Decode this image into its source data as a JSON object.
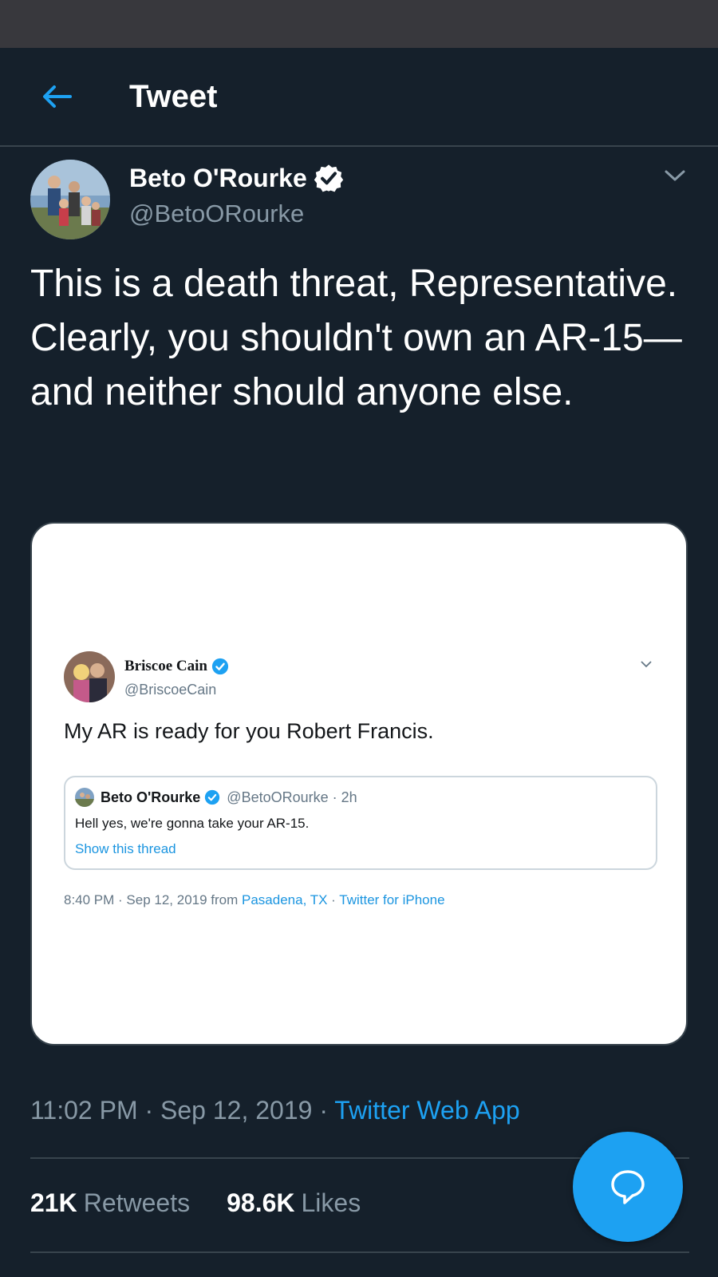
{
  "header": {
    "title": "Tweet",
    "back_icon": "arrow-left-icon"
  },
  "tweet": {
    "author_name": "Beto O'Rourke",
    "author_handle": "@BetoORourke",
    "text": "This is a death threat, Representative. Clearly, you shouldn't own an AR-15—and neither should anyone else.",
    "time": "11:02 PM",
    "date": "Sep 12, 2019",
    "source": "Twitter Web App",
    "retweets_count": "21K",
    "retweets_label": "Retweets",
    "likes_count": "98.6K",
    "likes_label": "Likes"
  },
  "media": {
    "quoted_name": "Briscoe Cain",
    "quoted_handle": "@BriscoeCain",
    "quoted_text": "My AR is ready for you Robert Francis.",
    "inner_name": "Beto O'Rourke",
    "inner_handle_time": "@BetoORourke · 2h",
    "inner_text": "Hell yes, we're gonna take your AR-15.",
    "inner_link": "Show this thread",
    "meta_time": "8:40 PM · Sep 12, 2019 from ",
    "meta_location": "Pasadena, TX",
    "meta_sep": " · ",
    "meta_source": "Twitter for iPhone"
  },
  "fab": {
    "icon": "reply-bubble-icon"
  },
  "colors": {
    "background": "#15202b",
    "accent": "#1da1f2",
    "secondary_text": "#8899a6",
    "divider": "#38444d"
  }
}
